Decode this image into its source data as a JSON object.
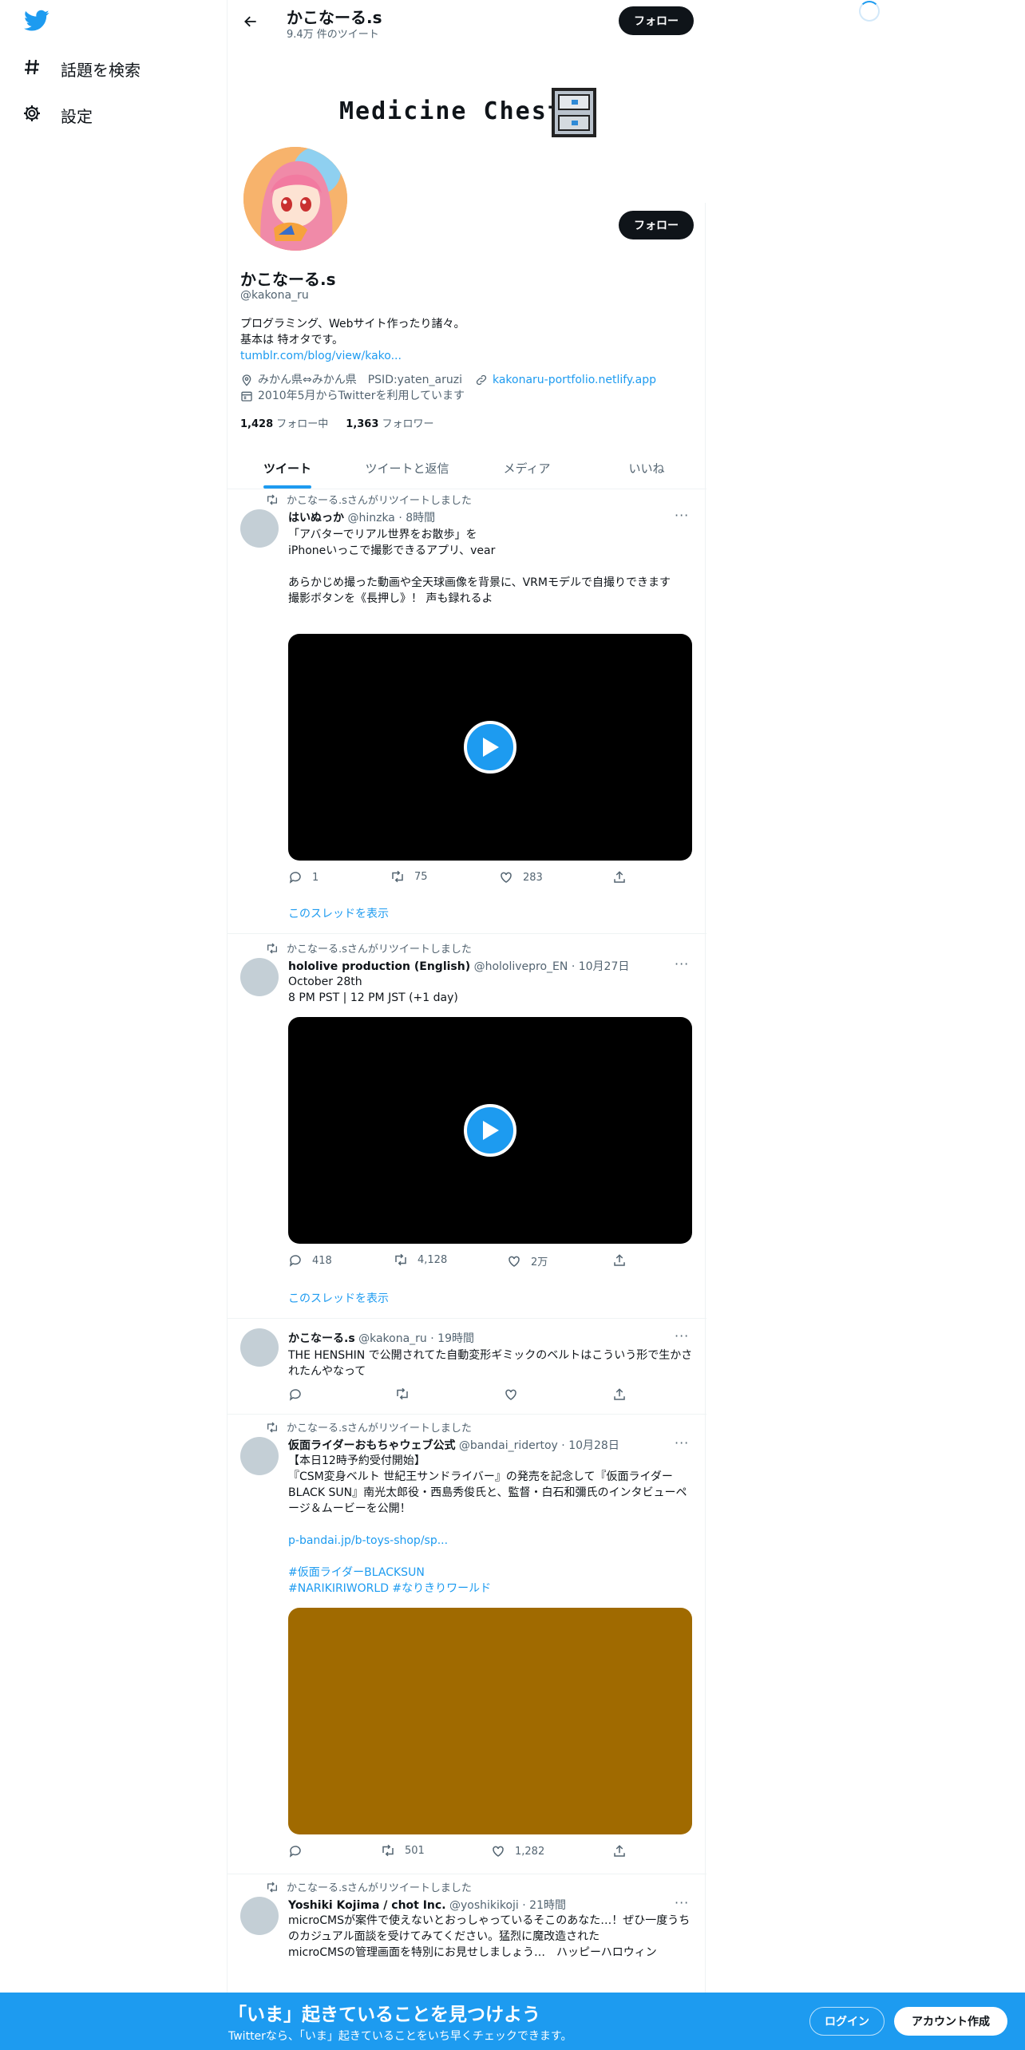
{
  "nav": {
    "explore_label": "話題を検索",
    "settings_label": "設定"
  },
  "header": {
    "name": "かこなーる.s",
    "tweet_count": "9.4万 件のツイート",
    "follow_label": "フォロー"
  },
  "banner": {
    "text": "Medicine Chest"
  },
  "profile": {
    "name": "かこなーる.s",
    "handle": "@kakona_ru",
    "follow_label": "フォロー",
    "bio_line1": "プログラミング、Webサイト作ったり諸々。",
    "bio_line2": "基本は 特オタです。",
    "bio_link": "tumblr.com/blog/view/kako...",
    "location": "みかん県⇔みかん県　PSID:yaten_aruzi",
    "website": "kakonaru-portfolio.netlify.app",
    "joined": "2010年5月からTwitterを利用しています",
    "following_count": "1,428",
    "following_label": "フォロー中",
    "followers_count": "1,363",
    "followers_label": "フォロワー"
  },
  "tabs": [
    "ツイート",
    "ツイートと返信",
    "メディア",
    "いいね"
  ],
  "retweet_label": "かこなーる.sさんがリツイートしました",
  "more_label": "···",
  "thread_label": "このスレッドを表示",
  "tweets": [
    {
      "name": "はいぬっか",
      "meta": "@hinzka · 8時間",
      "text": [
        "「アバターでリアル世界をお散歩」を",
        "iPhoneいっこで撮影できるアプリ、vear",
        "",
        "あらかじめ撮った動画や全天球画像を背景に、VRMモデルで自撮りできます",
        "撮影ボタンを《長押し》！ 声も録れるよ"
      ],
      "replies": "1",
      "retweets": "75",
      "likes": "283"
    },
    {
      "name": "hololive production (English)",
      "meta": "@hololivepro_EN · 10月27日",
      "text": [
        "October 28th",
        "8 PM PST | 12 PM JST (+1 day)"
      ],
      "replies": "418",
      "retweets": "4,128",
      "likes": "2万"
    },
    {
      "name": "かこなーる.s",
      "meta": "@kakona_ru · 19時間",
      "text": [
        "THE HENSHIN で公開されてた自動変形ギミックのベルトはこういう形で生かされたんやなって"
      ],
      "replies": "",
      "retweets": "",
      "likes": ""
    },
    {
      "name": "仮面ライダーおもちゃウェブ公式",
      "meta": "@bandai_ridertoy · 10月28日",
      "text": [
        "【本日12時予約受付開始】",
        "『CSM変身ベルト 世紀王サンドライバー』の発売を記念して『仮面ライダーBLACK SUN』南光太郎役・西島秀俊氏と、監督・白石和彌氏のインタビューページ＆ムービーを公開！"
      ],
      "link": "p-bandai.jp/b-toys-shop/sp...",
      "hashtags1": "#仮面ライダーBLACKSUN",
      "hashtags2": "#NARIKIRIWORLD #なりきりワールド",
      "media_color": "#a06a00",
      "replies": "",
      "retweets": "501",
      "likes": "1,282"
    },
    {
      "name": "Yoshiki Kojima / chot Inc.",
      "meta": "@yoshikikoji · 21時間",
      "text": [
        "microCMSが案件で使えないとおっしゃっているそこのあなた…！ぜひ一度うちのカジュアル面談を受けてみてください。猛烈に魔改造された",
        "microCMSの管理画面を特別にお見せしましょう…　ハッピーハロウィン"
      ]
    }
  ],
  "bottom_bar": {
    "title": "「いま」起きていることを見つけよう",
    "subtitle": "Twitterなら、「いま」起きていることをいち早くチェックできます。",
    "login_label": "ログイン",
    "signup_label": "アカウント作成"
  },
  "colors": {
    "accent": "#1d9bf0",
    "text": "#0f1419",
    "secondary": "#536471"
  }
}
